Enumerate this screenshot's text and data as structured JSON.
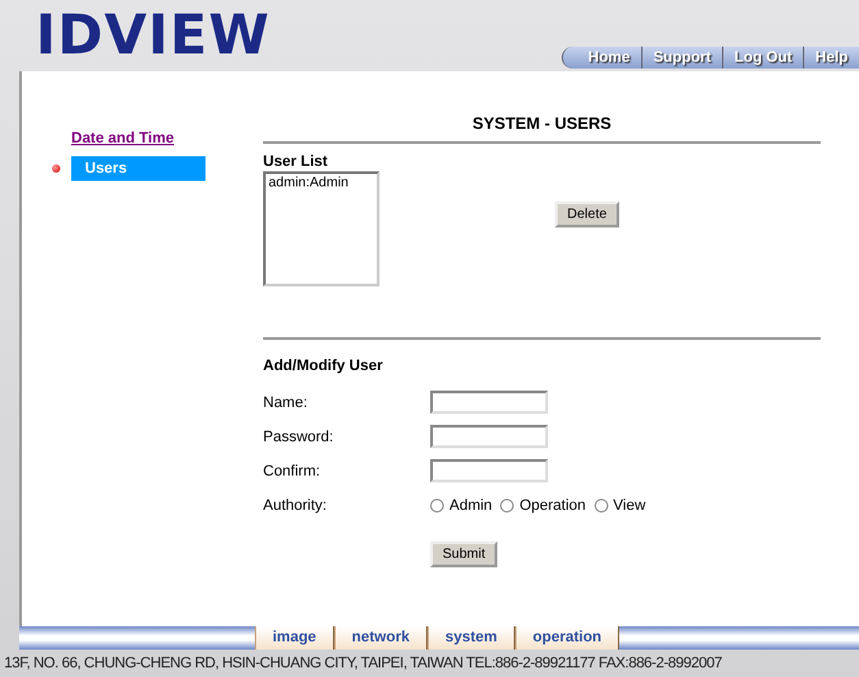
{
  "logo": {
    "text": "IDVIEW"
  },
  "top_nav": [
    {
      "label": "Home"
    },
    {
      "label": "Support"
    },
    {
      "label": "Log Out"
    },
    {
      "label": "Help"
    }
  ],
  "sidebar": {
    "items": [
      {
        "label": "Date and Time",
        "selected": false
      },
      {
        "label": "Users",
        "selected": true
      }
    ]
  },
  "page_title": "SYSTEM - USERS",
  "user_list": {
    "title": "User List",
    "items": [
      "admin:Admin"
    ],
    "delete_button": "Delete"
  },
  "add_modify": {
    "title": "Add/Modify User",
    "fields": [
      {
        "label": "Name:"
      },
      {
        "label": "Password:"
      },
      {
        "label": "Confirm:"
      }
    ],
    "authority": {
      "label": "Authority:",
      "options": [
        {
          "label": "Admin",
          "selected": false
        },
        {
          "label": "Operation",
          "selected": false
        },
        {
          "label": "View",
          "selected": false
        }
      ]
    },
    "submit": "Submit"
  },
  "bottom_tabs": [
    {
      "label": "image"
    },
    {
      "label": "network"
    },
    {
      "label": "system"
    },
    {
      "label": "operation"
    }
  ],
  "footer": "13F, NO. 66, CHUNG-CHENG RD, HSIN-CHUANG CITY, TAIPEI, TAIWAN  TEL:886-2-89921177 FAX:886-2-8992007"
}
